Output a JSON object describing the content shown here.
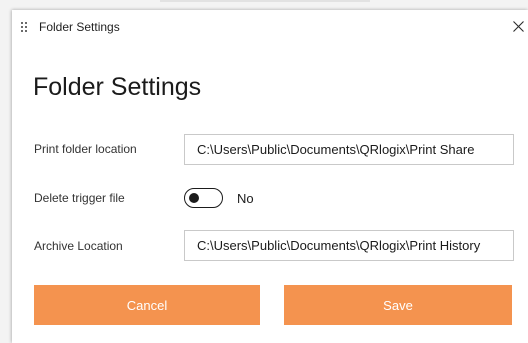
{
  "window": {
    "title": "Folder Settings",
    "close_glyph": "✕",
    "icon": "app-grid-icon"
  },
  "form": {
    "heading": "Folder Settings",
    "print_folder": {
      "label": "Print folder location",
      "value": "C:\\Users\\Public\\Documents\\QRlogix\\Print Share"
    },
    "delete_trigger": {
      "label": "Delete trigger file",
      "state": "No",
      "on": false
    },
    "archive": {
      "label": "Archive Location",
      "value": "C:\\Users\\Public\\Documents\\QRlogix\\Print History"
    }
  },
  "actions": {
    "cancel_label": "Cancel",
    "save_label": "Save"
  },
  "colors": {
    "accent": "#f4934f",
    "text": "#1b1b1b",
    "border": "#c9c9c9"
  }
}
